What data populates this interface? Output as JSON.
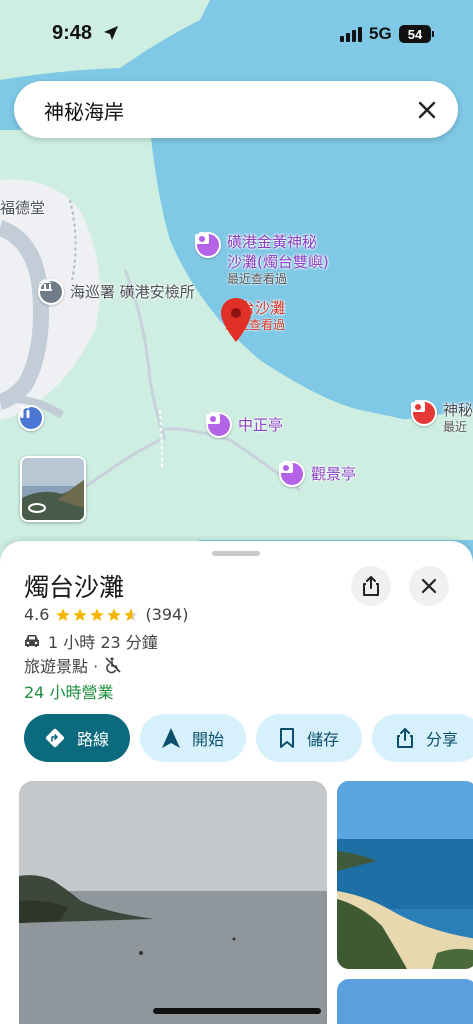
{
  "status_bar": {
    "time": "9:48",
    "network": "5G",
    "battery": "54"
  },
  "search": {
    "query": "神秘海岸",
    "clear_icon": "close-icon"
  },
  "map": {
    "colors": {
      "sea": "#7fc8e6",
      "land": "#cdeee0",
      "road": "#c2cdd8"
    },
    "labels": {
      "fude": "福德堂",
      "coastguard": "海巡署 磺港安檢所",
      "golden_title_1": "磺港金黃神秘",
      "golden_title_2": "沙灘(燭台雙嶼)",
      "golden_sub": "最近查看過",
      "selected_title": "燭台沙灘",
      "selected_sub": "最近查看過",
      "zhongzheng": "中正亭",
      "viewpoint": "觀景亭",
      "shenmi_title": "神秘",
      "shenmi_sub": "最近"
    }
  },
  "place": {
    "name": "燭台沙灘",
    "rating": "4.6",
    "stars": 4.6,
    "reviews": "(394)",
    "drive_time": "1 小時 23 分鐘",
    "category": "旅遊景點 ·",
    "hours": "24 小時營業"
  },
  "actions": {
    "directions": "路線",
    "start": "開始",
    "save": "儲存",
    "share": "分享"
  }
}
